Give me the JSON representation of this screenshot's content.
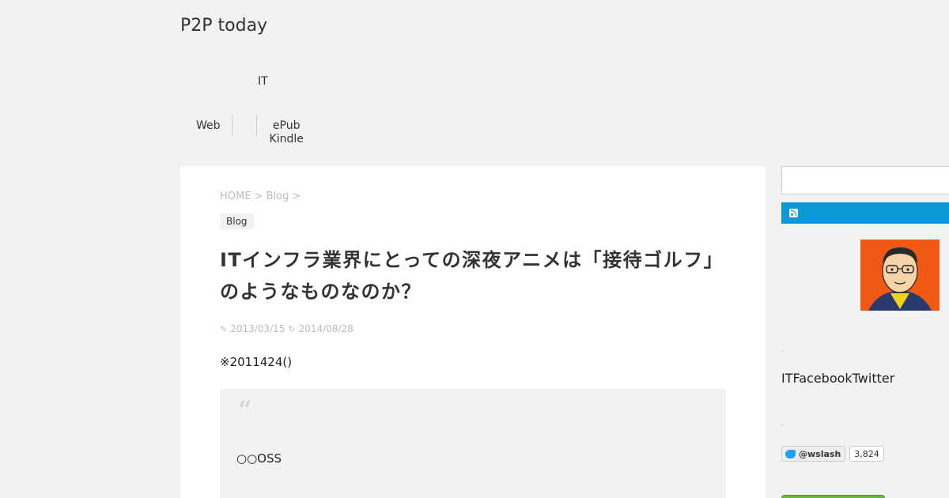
{
  "site": {
    "title": "P2P today"
  },
  "nav": {
    "top_item": "IT",
    "web": "Web",
    "ebook_line1": "ePub",
    "ebook_line2": "Kindle"
  },
  "breadcrumb": {
    "home": "HOME",
    "sep1": " > ",
    "blog": "Blog",
    "sep2": " >"
  },
  "post": {
    "category": "Blog",
    "title": "ITインフラ業界にとっての深夜アニメは「接待ゴルフ」のようなものなのか？",
    "published": "2013/03/15",
    "updated": "2014/08/28",
    "note": "※2011424()",
    "quote_mark": "“",
    "quote_text": "○○OSS"
  },
  "sidebar": {
    "search_placeholder": "",
    "tiny_mark": "'",
    "profile_text": "ITFacebookTwitter",
    "twitter_handle": "@wslash",
    "twitter_count": "3,824"
  },
  "colors": {
    "background": "#f2f2f2",
    "card": "#ffffff",
    "rss_bar": "#0a9ad8",
    "avatar_bg": "#f05a14",
    "follow_button": "#6bb63a"
  },
  "icons": {
    "published": "pencil-icon",
    "updated": "refresh-icon",
    "rss": "rss-icon",
    "twitter": "twitter-bird-icon"
  }
}
